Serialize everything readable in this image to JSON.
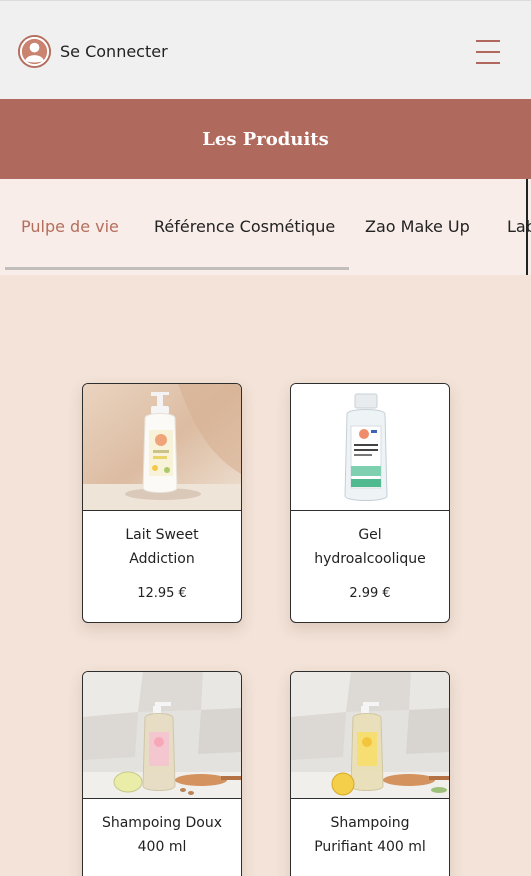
{
  "header": {
    "login_label": "Se Connecter",
    "avatar_icon": "user-avatar-icon",
    "menu_icon": "hamburger-menu-icon"
  },
  "banner": {
    "title": "Les Produits"
  },
  "tabs": [
    {
      "label": "Pulpe de vie",
      "active": true
    },
    {
      "label": "Référence Cosmétique",
      "active": false
    },
    {
      "label": "Zao Make Up",
      "active": false
    },
    {
      "label": "Lab",
      "active": false
    }
  ],
  "products": [
    {
      "name": "Lait Sweet Addiction",
      "price": "12.95 €"
    },
    {
      "name": "Gel hydroalcoolique",
      "price": "2.99 €"
    },
    {
      "name": "Shampoing Doux 400 ml",
      "price": ""
    },
    {
      "name": "Shampoing Purifiant 400 ml",
      "price": ""
    }
  ],
  "colors": {
    "accent": "#b0695d",
    "page_background": "#f3e3d8",
    "tabs_background": "#f8ede8",
    "header_background": "#f1f0f0"
  }
}
